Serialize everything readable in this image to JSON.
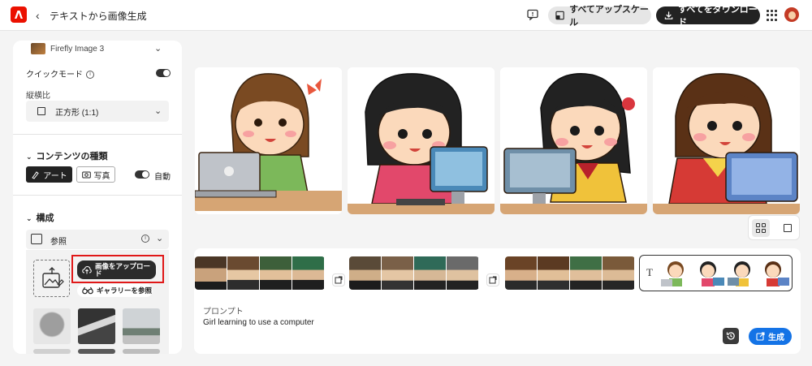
{
  "header": {
    "app_icon": "adobe-logo",
    "back_icon": "chevron-left-icon",
    "title": "テキストから画像生成",
    "upscale_all_label": "すべてアップスケール",
    "download_all_label": "すべてをダウンロード",
    "colors": {
      "brand": "#eb1000",
      "dark_button": "#222222"
    }
  },
  "left_panel": {
    "model_name": "Firefly Image 3",
    "quick_mode_label": "クイックモード",
    "quick_mode_on": true,
    "aspect_ratio_label": "縦横比",
    "aspect_ratio_value": "正方形 (1:1)",
    "content_type": {
      "title": "コンテンツの種類",
      "art_label": "アート",
      "photo_label": "写真",
      "auto_label": "自動",
      "selected": "アート"
    },
    "composition": {
      "title": "構成",
      "reference_label": "参照",
      "upload_label": "画像をアップロード",
      "gallery_label": "ギャラリーを参照"
    }
  },
  "results": {
    "images": [
      {
        "description": "Girl in green top at laptop"
      },
      {
        "description": "Girl in pink top at desktop"
      },
      {
        "description": "Girl in yellow top at desktop"
      },
      {
        "description": "Girl in red top at laptop"
      }
    ]
  },
  "prompt": {
    "label": "プロンプト",
    "text": "Girl learning to use a computer",
    "generate_label": "生成",
    "accent": "#1473e6"
  }
}
